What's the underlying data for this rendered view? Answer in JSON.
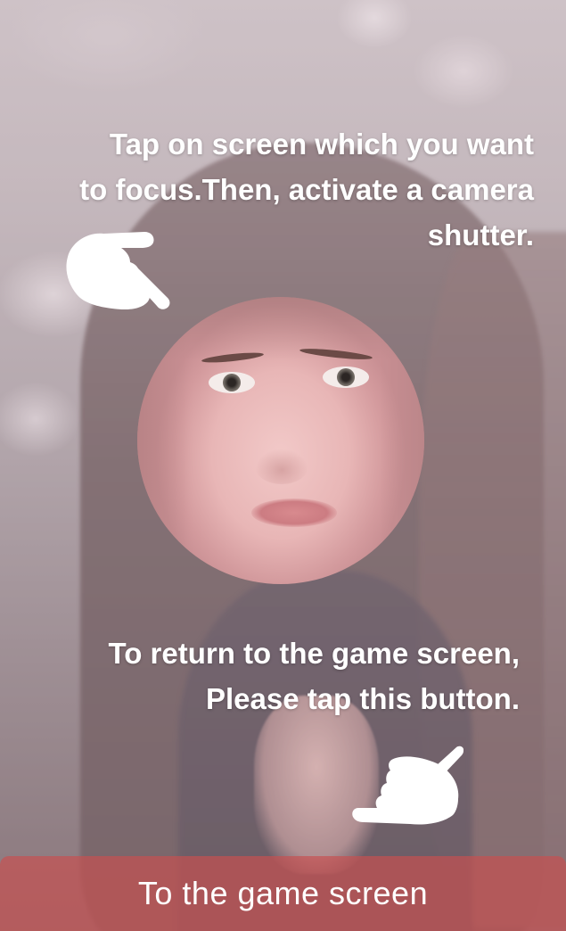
{
  "instructions": {
    "focus_tip": "Tap on screen which you want\nto focus.Then, activate a camera\nshutter.",
    "return_tip": "To return to the game screen,\nPlease tap this button."
  },
  "button": {
    "label": "To the game screen"
  },
  "icons": {
    "top_hand": "pointing-hand-icon",
    "bottom_hand": "pointing-hand-icon"
  },
  "colors": {
    "button_background": "#c85050",
    "text": "#ffffff"
  }
}
